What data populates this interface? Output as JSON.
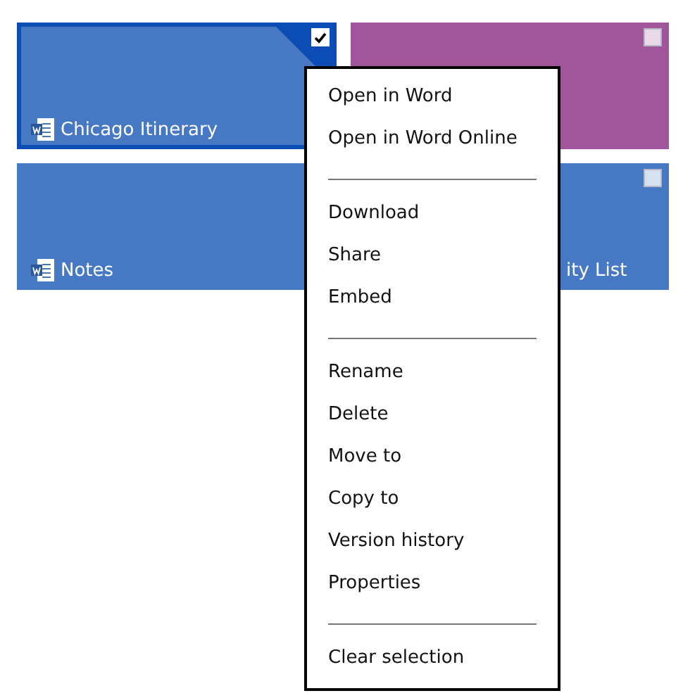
{
  "tiles": [
    {
      "label": "Chicago Itinerary",
      "file_icon": true,
      "selected": true,
      "color": "#4778c4"
    },
    {
      "selected": false,
      "color": "#a0569a"
    },
    {
      "label": "Notes",
      "file_icon": true,
      "color": "#4778c4"
    },
    {
      "label": "ity List",
      "selected": false,
      "color": "#4778c4"
    }
  ],
  "context_menu": {
    "sections": [
      [
        "Open in Word",
        "Open in Word Online"
      ],
      [
        "Download",
        "Share",
        "Embed"
      ],
      [
        "Rename",
        "Delete",
        "Move to",
        "Copy to",
        "Version history",
        "Properties"
      ],
      [
        "Clear selection"
      ]
    ]
  }
}
